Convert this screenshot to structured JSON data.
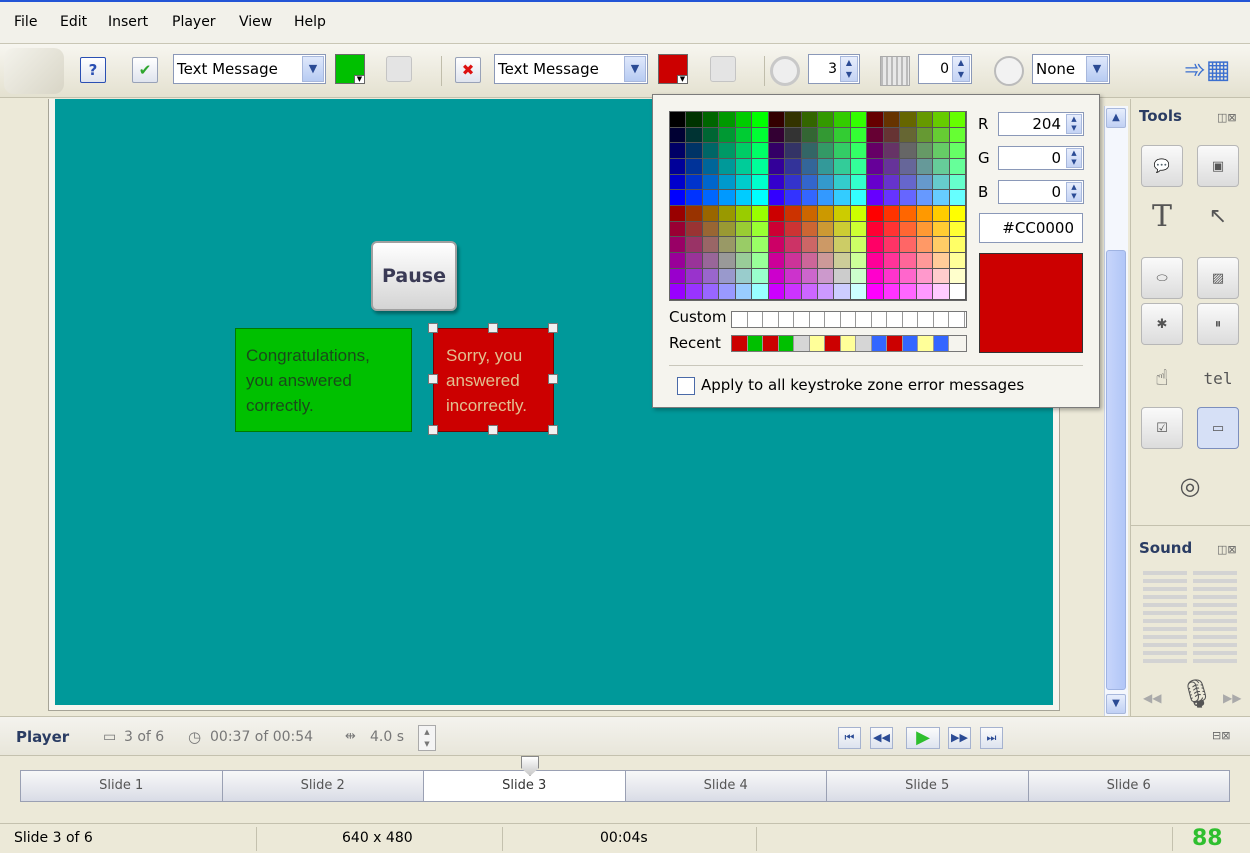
{
  "menu": [
    "File",
    "Edit",
    "Insert",
    "Player",
    "View",
    "Help"
  ],
  "toolbar": {
    "help_label": "?",
    "correct_message_type": "Text Message",
    "correct_color": "#00c000",
    "incorrect_message_type": "Text Message",
    "incorrect_color": "#cc0000",
    "attempts_value": "3",
    "grid_value": "0",
    "timer_value": "None"
  },
  "stage": {
    "background": "#00999a",
    "pause_button_label": "Pause",
    "correct_message": "Congratulations, you answered correctly.",
    "incorrect_message": "Sorry, you answered incorrectly."
  },
  "color_picker": {
    "r_label": "R",
    "r_value": "204",
    "g_label": "G",
    "g_value": "0",
    "b_label": "B",
    "b_value": "0",
    "hex_value": "#CC0000",
    "preview_color": "#cc0000",
    "custom_label": "Custom",
    "recent_label": "Recent",
    "recent_colors": [
      "#cc0000",
      "#00c000",
      "#cc0000",
      "#00c000",
      "#d6d6d6",
      "#ffff99",
      "#cc0000",
      "#ffff99",
      "#d6d6d6",
      "#3366ff",
      "#cc0000",
      "#3366ff",
      "#ffff99",
      "#3366ff"
    ],
    "apply_all_label": "Apply to all keystroke zone error messages"
  },
  "tools_panel": {
    "title": "Tools"
  },
  "sound_panel": {
    "title": "Sound"
  },
  "player": {
    "title": "Player",
    "slide_position": "3 of 6",
    "time_position": "00:37 of 00:54",
    "duration": "4.0 s"
  },
  "slides": [
    "Slide 1",
    "Slide 2",
    "Slide 3",
    "Slide 4",
    "Slide 5",
    "Slide 6"
  ],
  "current_slide_index": 2,
  "status": {
    "slide": "Slide 3 of 6",
    "dimensions": "640 x 480",
    "time": "00:04s"
  }
}
